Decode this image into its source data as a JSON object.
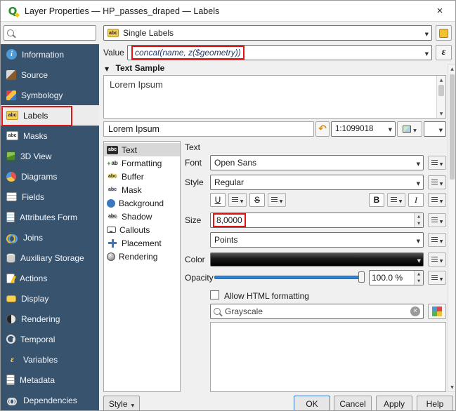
{
  "window": {
    "title": "Layer Properties — HP_passes_draped — Labels"
  },
  "icons": {
    "close": "×",
    "expression": "ε",
    "reset": "↶",
    "dropdown": "▼"
  },
  "colors": {
    "sidebar_bg": "#37536e",
    "annotation_red": "#e01515",
    "slider_blue": "#2a84d8",
    "selection_gray": "#d8d8d8"
  },
  "sidebar": {
    "items": [
      {
        "label": "Information"
      },
      {
        "label": "Source"
      },
      {
        "label": "Symbology"
      },
      {
        "label": "Labels",
        "selected": true
      },
      {
        "label": "Masks"
      },
      {
        "label": "3D View"
      },
      {
        "label": "Diagrams"
      },
      {
        "label": "Fields"
      },
      {
        "label": "Attributes Form"
      },
      {
        "label": "Joins"
      },
      {
        "label": "Auxiliary Storage"
      },
      {
        "label": "Actions"
      },
      {
        "label": "Display"
      },
      {
        "label": "Rendering"
      },
      {
        "label": "Temporal"
      },
      {
        "label": "Variables"
      },
      {
        "label": "Metadata"
      },
      {
        "label": "Dependencies"
      }
    ]
  },
  "toolbar": {
    "label_mode": "Single Labels",
    "value_label": "Value",
    "value_expression": "concat(name, z($geometry))"
  },
  "text_sample": {
    "header": "Text Sample",
    "sample_text": "Lorem Ipsum",
    "preview_text": "Lorem Ipsum",
    "scale": "1:1099018"
  },
  "format_tabs": {
    "items": [
      {
        "label": "Text",
        "selected": true
      },
      {
        "label": "Formatting"
      },
      {
        "label": "Buffer"
      },
      {
        "label": "Mask"
      },
      {
        "label": "Background"
      },
      {
        "label": "Shadow"
      },
      {
        "label": "Callouts"
      },
      {
        "label": "Placement"
      },
      {
        "label": "Rendering"
      }
    ]
  },
  "text_panel": {
    "header": "Text",
    "font_label": "Font",
    "font_value": "Open Sans",
    "style_label": "Style",
    "style_value": "Regular",
    "underline_label": "U",
    "strikethrough_label": "S",
    "bold_label": "B",
    "italic_label": "I",
    "size_label": "Size",
    "size_value": "8,0000",
    "unit_value": "Points",
    "color_label": "Color",
    "opacity_label": "Opacity",
    "opacity_value": "100.0 %",
    "allow_html_label": "Allow HTML formatting",
    "search_value": "Grayscale"
  },
  "footer": {
    "style_label": "Style",
    "ok_label": "OK",
    "cancel_label": "Cancel",
    "apply_label": "Apply",
    "help_label": "Help"
  }
}
